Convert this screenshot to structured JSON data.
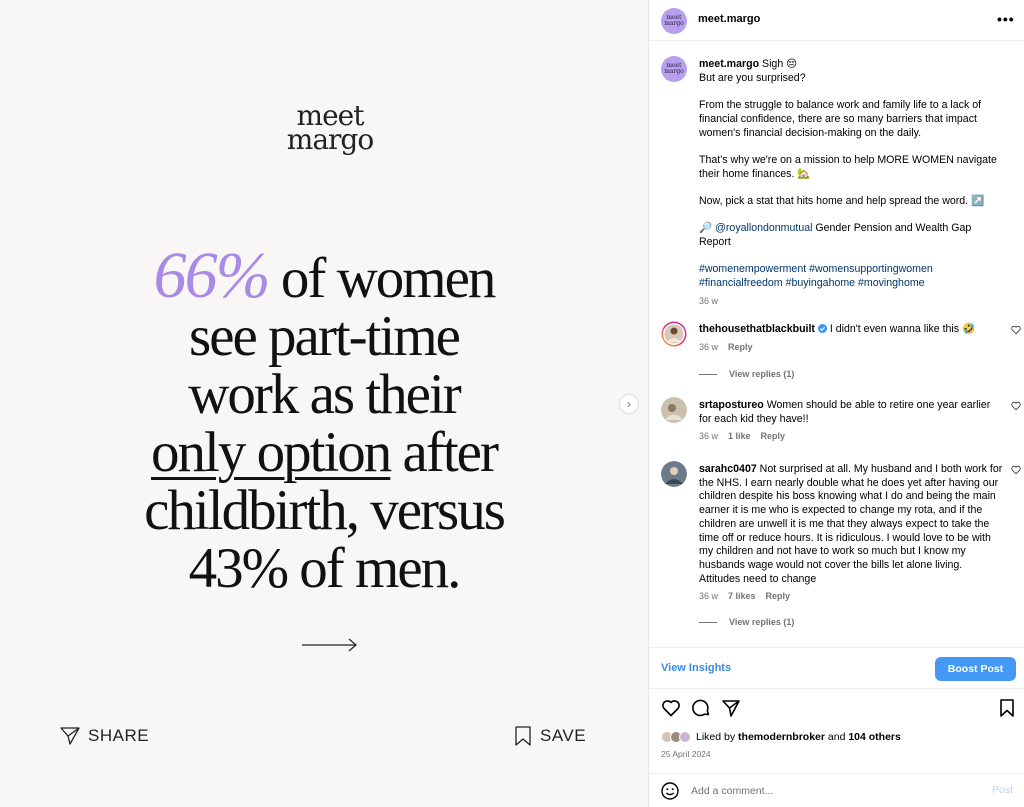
{
  "post": {
    "brand_logo": "meet margo",
    "headline": {
      "pct": "66%",
      "line1": " of women",
      "line2": "see part-time",
      "line3": "work as their",
      "line4_underlined": "only option",
      "line4_rest": " after",
      "line5": "childbirth, versus",
      "line6": "43% of men."
    },
    "share_label": "SHARE",
    "save_label": "SAVE"
  },
  "header": {
    "avatar_text": "meet margo",
    "username": "meet.margo",
    "more_label": "•••"
  },
  "caption": {
    "username": "meet.margo",
    "line1": " Sigh 😔",
    "line2": "But are you surprised?",
    "para2": "From the struggle to balance work and family life to a lack of financial confidence, there are so many barriers that impact women's financial decision-making on the daily.",
    "para3": "That's why we're on a mission to help MORE WOMEN navigate their home finances. 🏡",
    "para4": "Now, pick a stat that hits home and help spread the word. ↗️",
    "source_prefix": "🔎 ",
    "source_mention": "@royallondonmutual",
    "source_rest": " Gender Pension and Wealth Gap Report",
    "hashtags": "#womenempowerment #womensupportingwomen #financialfreedom #buyingahome #movinghome",
    "time": "36 w"
  },
  "comments": [
    {
      "username": "thehousethatblackbuilt",
      "verified": true,
      "text": " I didn't even wanna like this 🤣",
      "time": "36 w",
      "reply_label": "Reply",
      "view_replies": "View replies (1)"
    },
    {
      "username": "srtapostureo",
      "text": " Women should be able to retire one year earlier for each kid they have!!",
      "time": "36 w",
      "likes": "1 like",
      "reply_label": "Reply"
    },
    {
      "username": "sarahc0407",
      "text": " Not surprised at all. My husband and I both work for the NHS. I earn nearly double what he does yet after having our children despite his boss knowing what I do and being the main earner it is me who is expected to change my rota, and if the children are unwell it is me that they always expect to take the time off or reduce hours. It is ridiculous. I would love to be with my children and not have to work so much but I know my husbands wage would not cover the bills let alone living. Attitudes need to change",
      "time": "36 w",
      "likes": "7 likes",
      "reply_label": "Reply",
      "view_replies": "View replies (1)"
    }
  ],
  "insights": {
    "view_label": "View Insights",
    "boost_label": "Boost Post"
  },
  "likes": {
    "prefix": "Liked by ",
    "user": "themodernbroker",
    "mid": " and ",
    "count": "104 others"
  },
  "date": "25 April 2024",
  "add_comment": {
    "placeholder": "Add a comment...",
    "post_label": "Post"
  },
  "colors": {
    "accent_purple": "#a98ae6",
    "link_blue": "#00376b",
    "button_blue": "#4499f7",
    "muted_gray": "#737373"
  }
}
